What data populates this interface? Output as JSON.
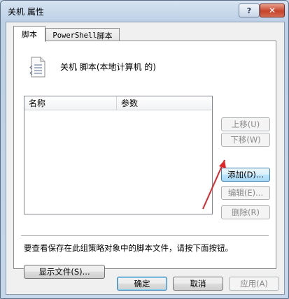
{
  "window": {
    "title": "关机 属性",
    "help_glyph": "?",
    "close_glyph": "✕"
  },
  "tabs": [
    {
      "label": "脚本",
      "selected": true
    },
    {
      "label_prefix": "PowerShell",
      "label_suffix": " 脚本",
      "selected": false
    }
  ],
  "panel": {
    "header": "关机 脚本(本地计算机 的)",
    "icon": "script-file-icon",
    "columns": [
      "名称",
      "参数"
    ],
    "rows": [],
    "buttons": {
      "up": "上移(U)",
      "down": "下移(W)",
      "add": "添加(D)...",
      "edit": "编辑(E)...",
      "remove": "删除(R)"
    },
    "info": "要查看保存在此组策略对象中的脚本文件，请按下面按钮。",
    "show_files": "显示文件(S)..."
  },
  "footer": {
    "ok": "确定",
    "cancel": "取消",
    "apply": "应用(A)"
  },
  "colors": {
    "annotation_arrow": "#e0242a",
    "focus_border": "#3c7fb1"
  }
}
